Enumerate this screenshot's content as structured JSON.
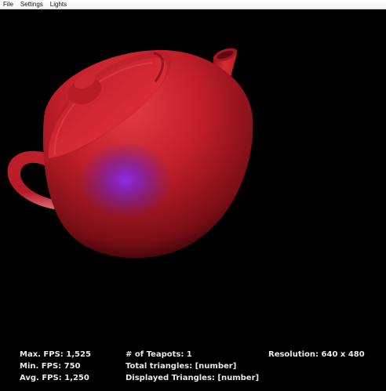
{
  "menu": {
    "file": "File",
    "settings": "Settings",
    "lights": "Lights"
  },
  "scene": {
    "object": "teapot",
    "teapot_color": "#c4202c",
    "light_color": "#7a28e0",
    "background": "#000000"
  },
  "stats": {
    "max_fps": "Max. FPS: 1,525",
    "min_fps": "Min. FPS: 750",
    "avg_fps": "Avg. FPS: 1,250",
    "teapots": "# of Teapots: 1",
    "total_triangles": "Total triangles: [number]",
    "displayed_triangles": "Displayed Triangles: [number]",
    "resolution": "Resolution: 640 x 480"
  }
}
